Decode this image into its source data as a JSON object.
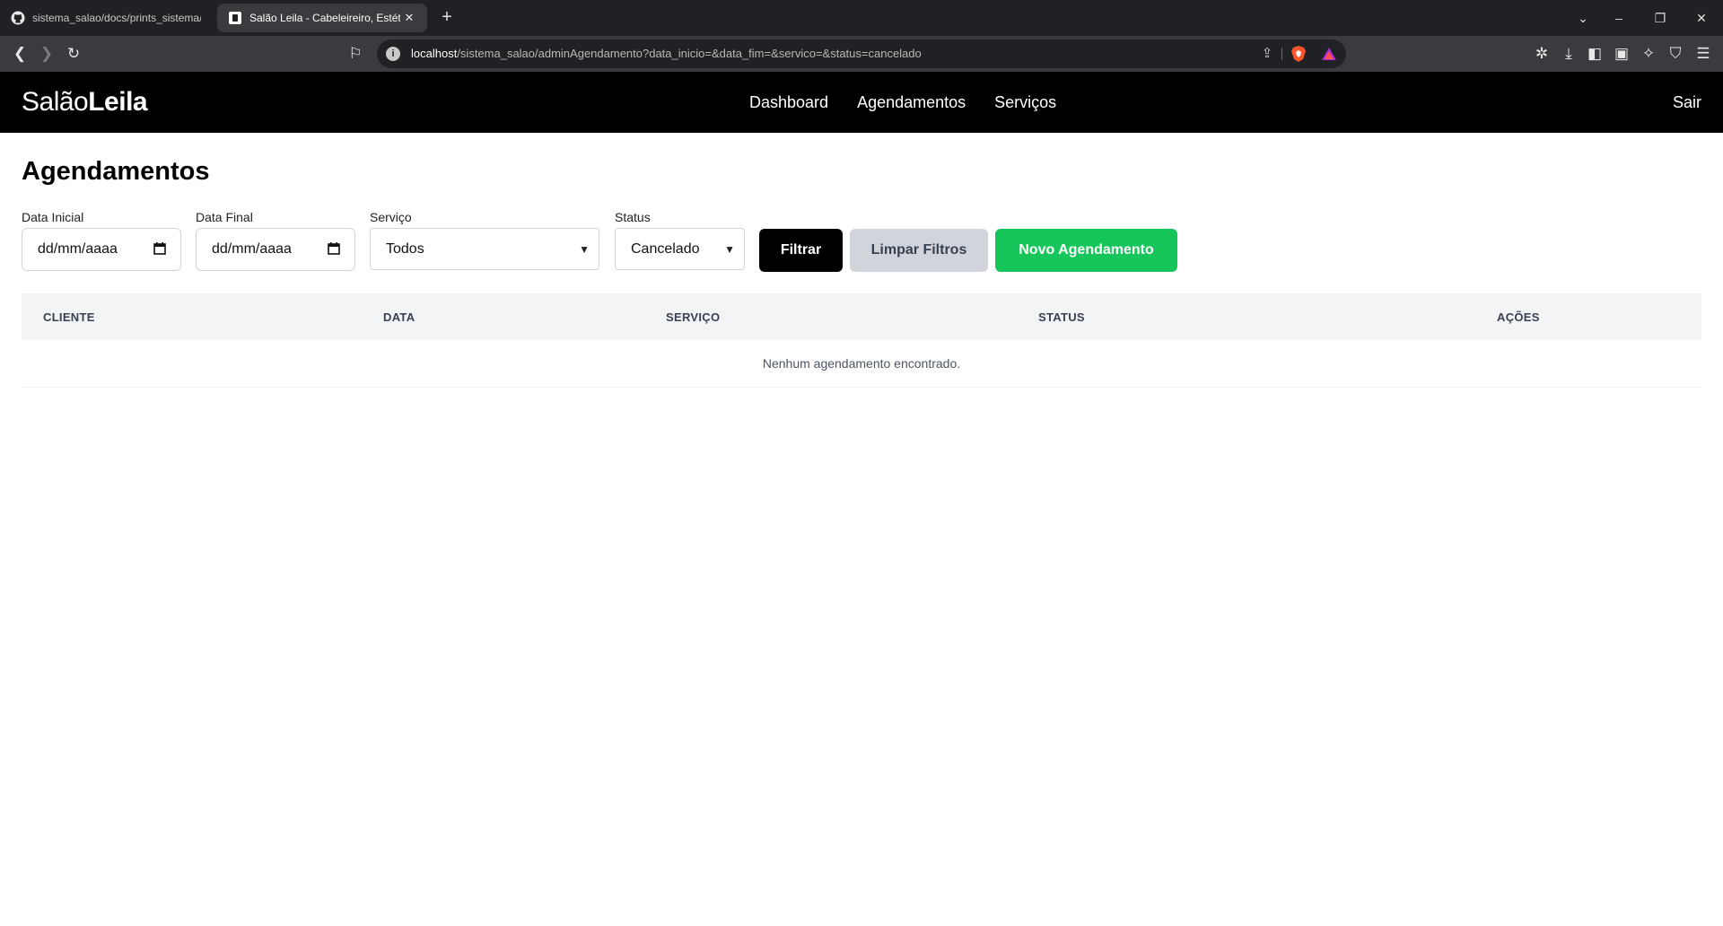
{
  "browser": {
    "tabs": [
      {
        "title": "sistema_salao/docs/prints_sistema/C",
        "icon": "github-icon"
      },
      {
        "title": "Salão Leila - Cabeleireiro, Estéti",
        "icon": "site-favicon"
      }
    ],
    "url_host": "localhost",
    "url_path": "/sistema_salao/adminAgendamento?data_inicio=&data_fim=&servico=&status=cancelado"
  },
  "site": {
    "logo_regular": "Salão",
    "logo_bold": "Leila",
    "nav": [
      "Dashboard",
      "Agendamentos",
      "Serviços"
    ],
    "logout": "Sair"
  },
  "page": {
    "title": "Agendamentos",
    "filters": {
      "data_inicial_label": "Data Inicial",
      "data_inicial_value": "dd/mm/aaaa",
      "data_final_label": "Data Final",
      "data_final_value": "dd/mm/aaaa",
      "servico_label": "Serviço",
      "servico_value": "Todos",
      "status_label": "Status",
      "status_value": "Cancelado"
    },
    "buttons": {
      "filtrar": "Filtrar",
      "limpar": "Limpar Filtros",
      "novo": "Novo Agendamento"
    },
    "table": {
      "headers": [
        "CLIENTE",
        "DATA",
        "SERVIÇO",
        "STATUS",
        "AÇÕES"
      ],
      "empty_message": "Nenhum agendamento encontrado."
    }
  },
  "colors": {
    "header_bg": "#000000",
    "primary_button": "#000000",
    "secondary_button": "#d1d5db",
    "success_button": "#16c65a",
    "table_header_bg": "#f3f4f6"
  }
}
